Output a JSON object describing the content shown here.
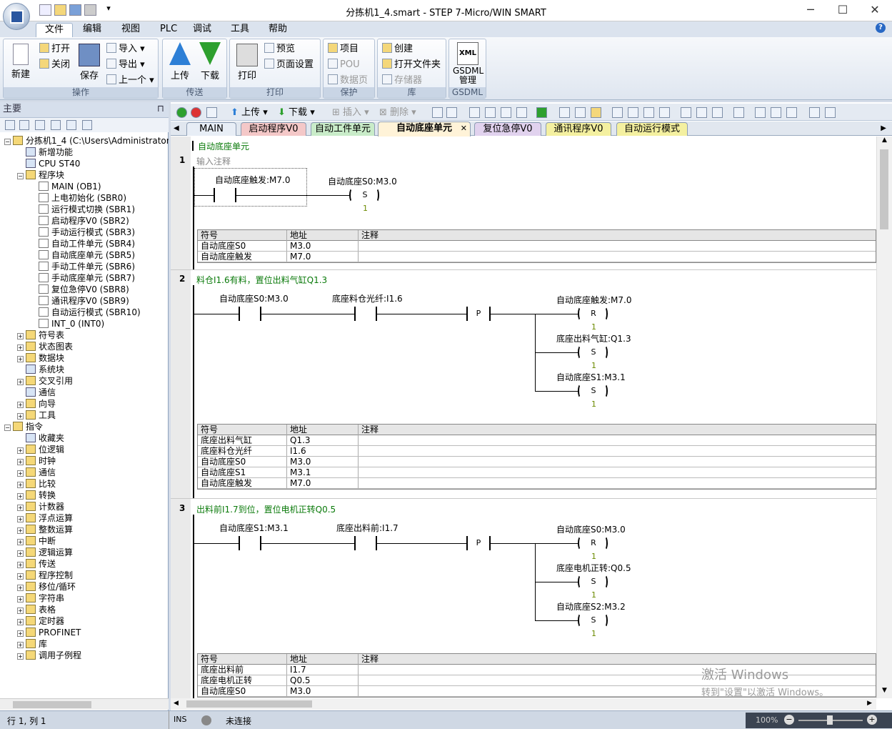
{
  "window": {
    "title": "分拣机1_4.smart - STEP 7-Micro/WIN SMART"
  },
  "menu": [
    "文件",
    "编辑",
    "视图",
    "PLC",
    "调试",
    "工具",
    "帮助"
  ],
  "ribbon": {
    "groups": [
      {
        "label": "操作",
        "big": [
          "新建",
          "保存"
        ],
        "small": [
          "打开",
          "关闭",
          "导入",
          "导出",
          "上一个"
        ]
      },
      {
        "label": "传送",
        "big": [
          "上传",
          "下载"
        ]
      },
      {
        "label": "打印",
        "big": [
          "打印"
        ],
        "small": [
          "预览",
          "页面设置"
        ]
      },
      {
        "label": "保护",
        "small": [
          "项目",
          "POU",
          "数据页"
        ]
      },
      {
        "label": "库",
        "small": [
          "创建",
          "打开文件夹",
          "存储器"
        ]
      },
      {
        "label": "GSDML",
        "big": [
          "GSDML\n管理"
        ],
        "xml": "XML"
      }
    ]
  },
  "left": {
    "title": "主要",
    "tree": [
      {
        "t": "分拣机1_4 (C:\\Users\\Administrator\\Des",
        "lvl": 0,
        "exp": "-"
      },
      {
        "t": "新增功能",
        "lvl": 1
      },
      {
        "t": "CPU ST40",
        "lvl": 1
      },
      {
        "t": "程序块",
        "lvl": 1,
        "exp": "-"
      },
      {
        "t": "MAIN (OB1)",
        "lvl": 2
      },
      {
        "t": "上电初始化 (SBR0)",
        "lvl": 2
      },
      {
        "t": "运行模式切换 (SBR1)",
        "lvl": 2
      },
      {
        "t": "启动程序V0 (SBR2)",
        "lvl": 2
      },
      {
        "t": "手动运行模式 (SBR3)",
        "lvl": 2
      },
      {
        "t": "自动工件单元 (SBR4)",
        "lvl": 2
      },
      {
        "t": "自动底座单元 (SBR5)",
        "lvl": 2
      },
      {
        "t": "手动工件单元 (SBR6)",
        "lvl": 2
      },
      {
        "t": "手动底座单元 (SBR7)",
        "lvl": 2
      },
      {
        "t": "复位急停V0 (SBR8)",
        "lvl": 2
      },
      {
        "t": "通讯程序V0 (SBR9)",
        "lvl": 2
      },
      {
        "t": "自动运行模式 (SBR10)",
        "lvl": 2
      },
      {
        "t": "INT_0 (INT0)",
        "lvl": 2
      },
      {
        "t": "符号表",
        "lvl": 1,
        "exp": "+"
      },
      {
        "t": "状态图表",
        "lvl": 1,
        "exp": "+"
      },
      {
        "t": "数据块",
        "lvl": 1,
        "exp": "+"
      },
      {
        "t": "系统块",
        "lvl": 1
      },
      {
        "t": "交叉引用",
        "lvl": 1,
        "exp": "+"
      },
      {
        "t": "通信",
        "lvl": 1
      },
      {
        "t": "向导",
        "lvl": 1,
        "exp": "+"
      },
      {
        "t": "工具",
        "lvl": 1,
        "exp": "+"
      },
      {
        "t": "指令",
        "lvl": 0,
        "exp": "-"
      },
      {
        "t": "收藏夹",
        "lvl": 1
      },
      {
        "t": "位逻辑",
        "lvl": 1,
        "exp": "+"
      },
      {
        "t": "时钟",
        "lvl": 1,
        "exp": "+"
      },
      {
        "t": "通信",
        "lvl": 1,
        "exp": "+"
      },
      {
        "t": "比较",
        "lvl": 1,
        "exp": "+"
      },
      {
        "t": "转换",
        "lvl": 1,
        "exp": "+"
      },
      {
        "t": "计数器",
        "lvl": 1,
        "exp": "+"
      },
      {
        "t": "浮点运算",
        "lvl": 1,
        "exp": "+"
      },
      {
        "t": "整数运算",
        "lvl": 1,
        "exp": "+"
      },
      {
        "t": "中断",
        "lvl": 1,
        "exp": "+"
      },
      {
        "t": "逻辑运算",
        "lvl": 1,
        "exp": "+"
      },
      {
        "t": "传送",
        "lvl": 1,
        "exp": "+"
      },
      {
        "t": "程序控制",
        "lvl": 1,
        "exp": "+"
      },
      {
        "t": "移位/循环",
        "lvl": 1,
        "exp": "+"
      },
      {
        "t": "字符串",
        "lvl": 1,
        "exp": "+"
      },
      {
        "t": "表格",
        "lvl": 1,
        "exp": "+"
      },
      {
        "t": "定时器",
        "lvl": 1,
        "exp": "+"
      },
      {
        "t": "PROFINET",
        "lvl": 1,
        "exp": "+"
      },
      {
        "t": "库",
        "lvl": 1,
        "exp": "+"
      },
      {
        "t": "调用子例程",
        "lvl": 1,
        "exp": "+"
      }
    ]
  },
  "toolbar": [
    "上传",
    "下载",
    "插入",
    "删除"
  ],
  "tabs": [
    {
      "label": "MAIN",
      "color": "#e8eef6"
    },
    {
      "label": "启动程序V0",
      "color": "#f4c8c8"
    },
    {
      "label": "自动工件单元",
      "color": "#c9ecc9"
    },
    {
      "label": "自动底座单元",
      "color": "#fff3d8",
      "active": true,
      "close": "✕"
    },
    {
      "label": "复位急停V0",
      "color": "#e1d2ee"
    },
    {
      "label": "通讯程序V0",
      "color": "#f4f0a0"
    },
    {
      "label": "自动运行模式",
      "color": "#f4f0a0"
    }
  ],
  "program": {
    "title": "自动底座单元",
    "symtab_headers": [
      "符号",
      "地址",
      "注释"
    ],
    "networks": [
      {
        "num": "1",
        "comment": "输入注释",
        "contacts": [
          "自动底座触发:M7.0"
        ],
        "coils": [
          {
            "label": "自动底座S0:M3.0",
            "type": "S",
            "n": "1"
          }
        ],
        "symbols": [
          [
            "自动底座S0",
            "M3.0"
          ],
          [
            "自动底座触发",
            "M7.0"
          ]
        ]
      },
      {
        "num": "2",
        "comment": "料仓I1.6有料，置位出料气缸Q1.3",
        "contacts": [
          "自动底座S0:M3.0",
          "底座料仓光纤:I1.6"
        ],
        "p": "P",
        "coils": [
          {
            "label": "自动底座触发:M7.0",
            "type": "R",
            "n": "1"
          },
          {
            "label": "底座出料气缸:Q1.3",
            "type": "S",
            "n": "1"
          },
          {
            "label": "自动底座S1:M3.1",
            "type": "S",
            "n": "1"
          }
        ],
        "symbols": [
          [
            "底座出料气缸",
            "Q1.3"
          ],
          [
            "底座料仓光纤",
            "I1.6"
          ],
          [
            "自动底座S0",
            "M3.0"
          ],
          [
            "自动底座S1",
            "M3.1"
          ],
          [
            "自动底座触发",
            "M7.0"
          ]
        ]
      },
      {
        "num": "3",
        "comment": "出料前I1.7到位，置位电机正转Q0.5",
        "contacts": [
          "自动底座S1:M3.1",
          "底座出料前:I1.7"
        ],
        "p": "P",
        "coils": [
          {
            "label": "自动底座S0:M3.0",
            "type": "R",
            "n": "1"
          },
          {
            "label": "底座电机正转:Q0.5",
            "type": "S",
            "n": "1"
          },
          {
            "label": "自动底座S2:M3.2",
            "type": "S",
            "n": "1"
          }
        ],
        "symbols": [
          [
            "底座出料前",
            "I1.7"
          ],
          [
            "底座电机正转",
            "Q0.5"
          ],
          [
            "自动底座S0",
            "M3.0"
          ]
        ]
      }
    ]
  },
  "watermark": {
    "line1": "激活 Windows",
    "line2": "转到\"设置\"以激活 Windows。"
  },
  "status": {
    "pos": "行 1, 列 1",
    "mode": "INS",
    "conn": "未连接",
    "zoom": "100%"
  }
}
